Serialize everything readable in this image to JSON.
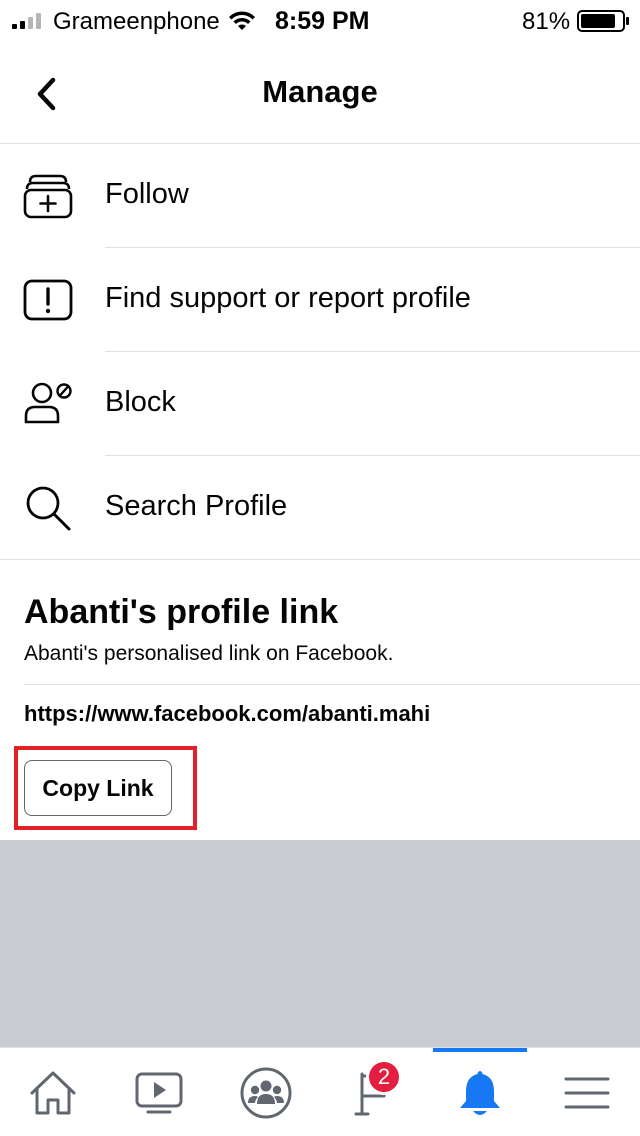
{
  "status_bar": {
    "carrier": "Grameenphone",
    "time": "8:59 PM",
    "battery": "81%"
  },
  "header": {
    "title": "Manage",
    "back_icon": "chevron-left-icon"
  },
  "menu": {
    "items": [
      {
        "label": "Follow",
        "icon": "follow-icon"
      },
      {
        "label": "Find support or report profile",
        "icon": "report-icon"
      },
      {
        "label": "Block",
        "icon": "block-user-icon"
      },
      {
        "label": "Search Profile",
        "icon": "search-icon"
      }
    ]
  },
  "profile_link": {
    "title": "Abanti's profile link",
    "subtitle": "Abanti's personalised link on Facebook.",
    "url": "https://www.facebook.com/abanti.mahi",
    "copy_label": "Copy Link"
  },
  "tab_bar": {
    "tabs": [
      {
        "name": "home",
        "icon": "home-icon"
      },
      {
        "name": "watch",
        "icon": "video-icon"
      },
      {
        "name": "groups",
        "icon": "groups-icon"
      },
      {
        "name": "pages",
        "icon": "flag-icon"
      },
      {
        "name": "notifications",
        "icon": "bell-icon",
        "active": true
      },
      {
        "name": "menu",
        "icon": "hamburger-icon"
      }
    ],
    "pages_badge": "2"
  },
  "colors": {
    "accent": "#1877f2",
    "highlight": "#e3202a",
    "badge": "#e41e3f",
    "gray_area": "#c9ccd1"
  }
}
